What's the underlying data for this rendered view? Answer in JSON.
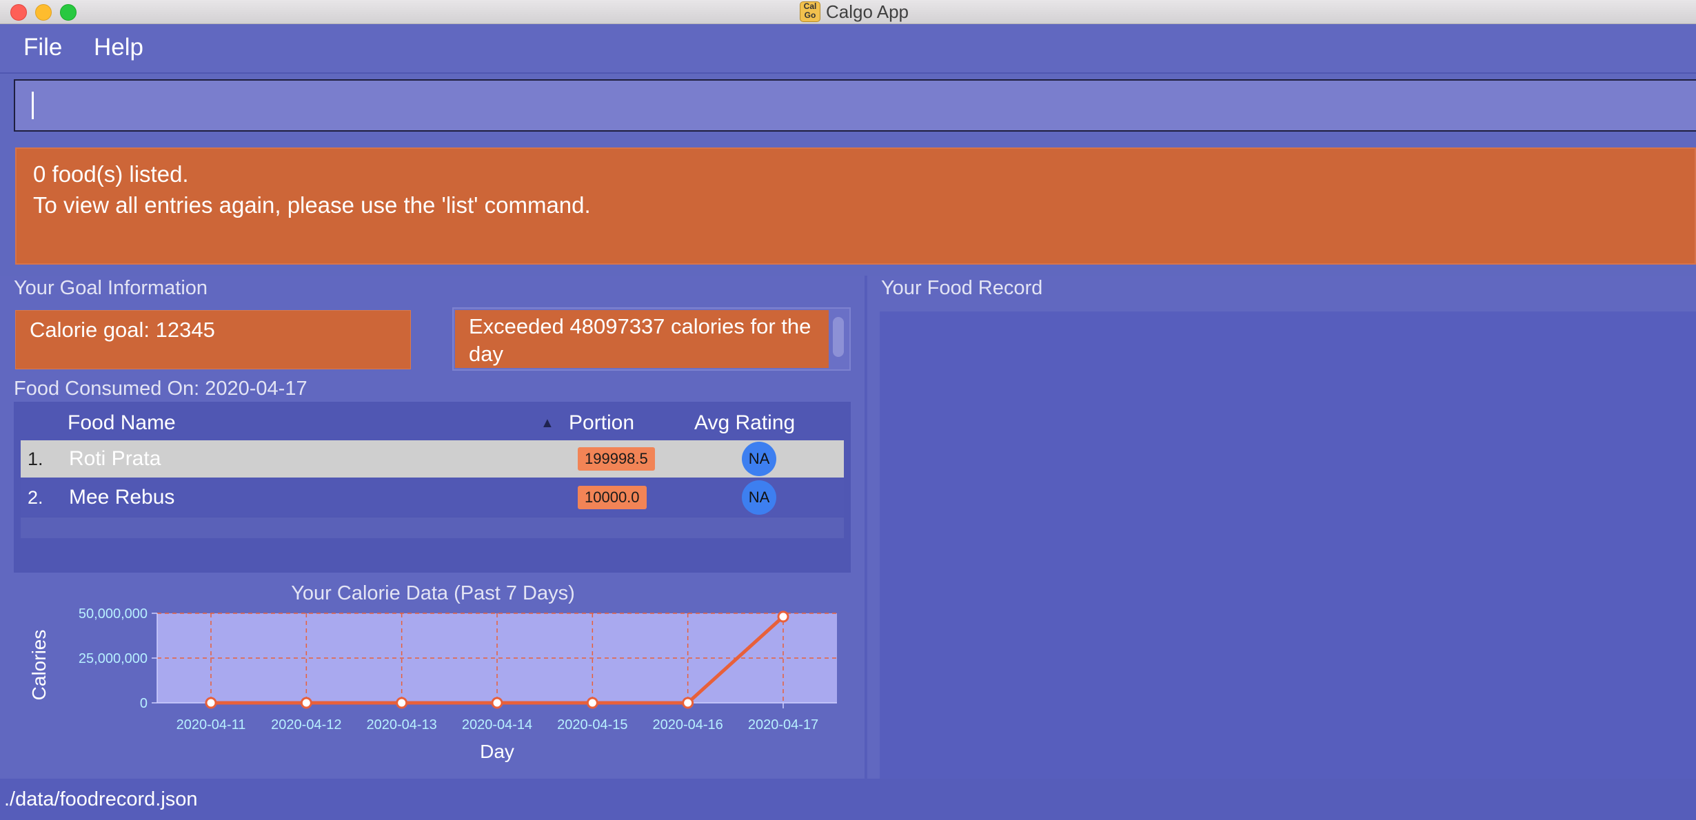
{
  "window": {
    "title": "Calgo App",
    "icon_text": "Cal\nGo"
  },
  "menu": {
    "file": "File",
    "help": "Help"
  },
  "command": {
    "value": ""
  },
  "result": {
    "text": "0 food(s) listed.\nTo view all entries again, please use the 'list' command."
  },
  "goal": {
    "section_title": "Your Goal Information",
    "calorie_goal": "Calorie goal: 12345",
    "exceeded": "Exceeded 48097337 calories for the day"
  },
  "consumed": {
    "title": "Food Consumed On: 2020-04-17",
    "headers": {
      "name": "Food Name",
      "portion": "Portion",
      "rating": "Avg Rating"
    },
    "rows": [
      {
        "index": "1.",
        "name": "Roti Prata",
        "portion": "199998.5",
        "rating": "NA",
        "selected": true
      },
      {
        "index": "2.",
        "name": "Mee Rebus",
        "portion": "10000.0",
        "rating": "NA",
        "selected": false
      }
    ]
  },
  "record": {
    "section_title": "Your Food Record"
  },
  "status": {
    "path": "./data/foodrecord.json"
  },
  "chart_data": {
    "type": "line",
    "title": "Your Calorie Data (Past 7 Days)",
    "xlabel": "Day",
    "ylabel": "Calories",
    "categories": [
      "2020-04-11",
      "2020-04-12",
      "2020-04-13",
      "2020-04-14",
      "2020-04-15",
      "2020-04-16",
      "2020-04-17"
    ],
    "values": [
      0,
      0,
      0,
      0,
      0,
      0,
      48109682
    ],
    "ylim": [
      0,
      50000000
    ],
    "yticks": [
      0,
      25000000,
      50000000
    ],
    "ytick_labels": [
      "0",
      "25,000,000",
      "50,000,000"
    ],
    "grid": true,
    "colors": {
      "line": "#e8603a",
      "plot_bg": "#a9a9ef",
      "grid": "#e8603a",
      "tick_text": "#b8f0ff"
    }
  }
}
